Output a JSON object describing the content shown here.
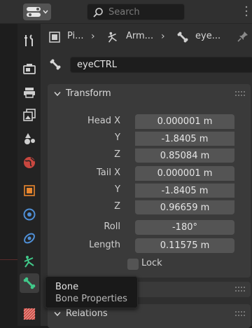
{
  "header": {
    "editor_type_icon": "properties-editor-icon",
    "search_placeholder": "Search"
  },
  "tabs": [
    {
      "name": "tool",
      "icon": "tool-icon"
    },
    {
      "name": "render",
      "icon": "render-icon"
    },
    {
      "name": "output",
      "icon": "output-icon"
    },
    {
      "name": "view-layer",
      "icon": "view-layer-icon"
    },
    {
      "name": "scene",
      "icon": "scene-icon"
    },
    {
      "name": "world",
      "icon": "world-icon"
    },
    {
      "name": "object",
      "icon": "object-icon"
    },
    {
      "name": "modifiers",
      "icon": "modifier-icon"
    },
    {
      "name": "physics",
      "icon": "physics-icon"
    },
    {
      "name": "armature-data",
      "icon": "armature-icon"
    },
    {
      "name": "bone",
      "icon": "bone-icon",
      "active": true
    },
    {
      "name": "bone-constraints",
      "icon": "bone-constraint-icon"
    }
  ],
  "breadcrumb": {
    "items": [
      "Pi...",
      "Arm...",
      "eye..."
    ]
  },
  "bone_name": "eyeCTRL",
  "transform": {
    "title": "Transform",
    "head_x_label": "Head X",
    "head_x": "0.000001 m",
    "head_y_label": "Y",
    "head_y": "-1.8405 m",
    "head_z_label": "Z",
    "head_z": "0.85084 m",
    "tail_x_label": "Tail X",
    "tail_x": "0.000001 m",
    "tail_y_label": "Y",
    "tail_y": "-1.8405 m",
    "tail_z_label": "Z",
    "tail_z": "0.96659 m",
    "roll_label": "Roll",
    "roll": "-180°",
    "length_label": "Length",
    "length": "0.11575 m",
    "lock_label": "Lock",
    "lock_checked": false
  },
  "relations": {
    "title": "Relations"
  },
  "tooltip": {
    "title": "Bone",
    "description": "Bone Properties"
  },
  "colors": {
    "active_tab": "#3d3d3d",
    "field_bg": "#545454",
    "panel_bg": "#3a3a3a",
    "bone_tab_green": "#41c98a"
  }
}
